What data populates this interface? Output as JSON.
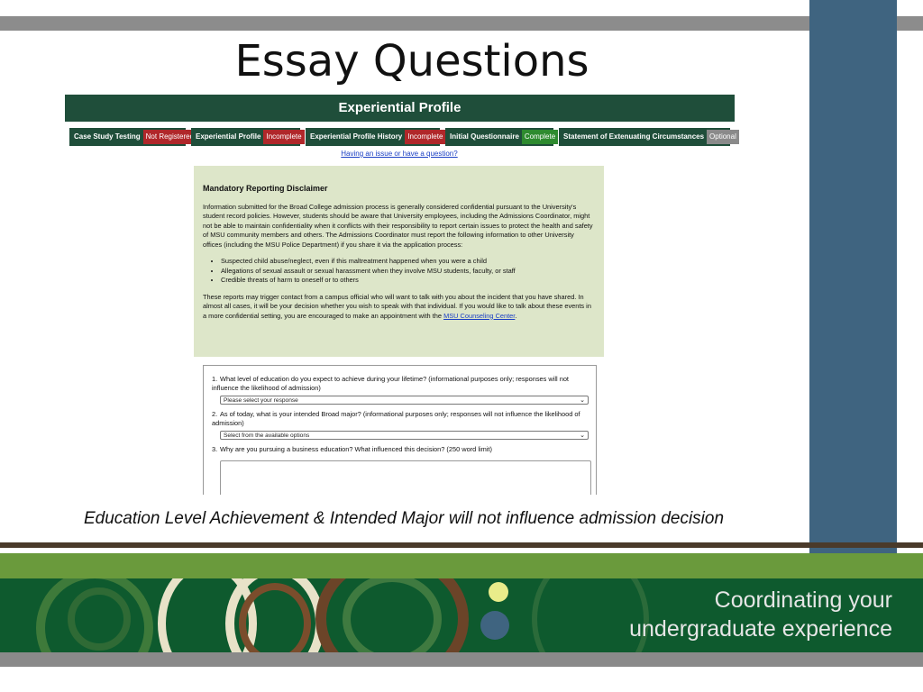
{
  "slide": {
    "title": "Essay Questions",
    "caption": "Education Level Achievement & Intended Major will not influence admission decision",
    "tagline_line1": "Coordinating your",
    "tagline_line2": "undergraduate experience"
  },
  "screenshot": {
    "header": "Experiential Profile",
    "tabs": [
      {
        "label": "Case Study Testing",
        "status": "Not Registered",
        "status_color": "#b0272a"
      },
      {
        "label": "Experiential Profile",
        "status": "Incomplete",
        "status_color": "#b0272a"
      },
      {
        "label": "Experiential Profile History",
        "status": "Incomplete",
        "status_color": "#b0272a"
      },
      {
        "label": "Initial Questionnaire",
        "status": "Complete",
        "status_color": "#2e8b2f"
      },
      {
        "label": "Statement of Extenuating Circumstances",
        "status": "Optional",
        "status_color": "#8a8a8a"
      }
    ],
    "help_link": "Having an issue or have a question?",
    "disclaimer": {
      "title": "Mandatory Reporting Disclaimer",
      "para1": "Information submitted for the Broad College admission process is generally considered confidential pursuant to the University's student record policies. However, students should be aware that University employees, including the Admissions Coordinator, might not be able to maintain confidentiality when it conflicts with their responsibility to report certain issues to protect the health and safety of MSU community members and others. The Admissions Coordinator must report the following information to other University offices (including the MSU Police Department) if you share it via the application process:",
      "bullets": [
        "Suspected child abuse/neglect, even if this maltreatment happened when you were a child",
        "Allegations of sexual assault or sexual harassment when they involve MSU students, faculty, or staff",
        "Credible threats of harm to oneself or to others"
      ],
      "para2_text": "These reports may trigger contact from a campus official who will want to talk with you about the incident that you have shared. In almost all cases, it will be your decision whether you wish to speak with that individual. If you would like to talk about these events in a more confidential setting, you are encouraged to make an appointment with the ",
      "para2_link": "MSU Counseling Center",
      "para2_end": "."
    },
    "questions": [
      {
        "number": "1.",
        "text": "What level of education do you expect to achieve during your lifetime? (informational purposes only; responses will not influence the likelihood of admission)",
        "select_value": "Please select your response"
      },
      {
        "number": "2.",
        "text": "As of today, what is your intended Broad major? (informational purposes only; responses will not influence the likelihood of admission)",
        "select_value": "Select from the available options"
      },
      {
        "number": "3.",
        "text": "Why are you pursuing a business education? What influenced this decision? (250 word limit)"
      }
    ]
  },
  "colors": {
    "header_green": "#1f4e3a",
    "disclaimer_bg": "#dde6c9",
    "band_green": "#0e5a2e",
    "right_column_blue": "#3f6480"
  }
}
